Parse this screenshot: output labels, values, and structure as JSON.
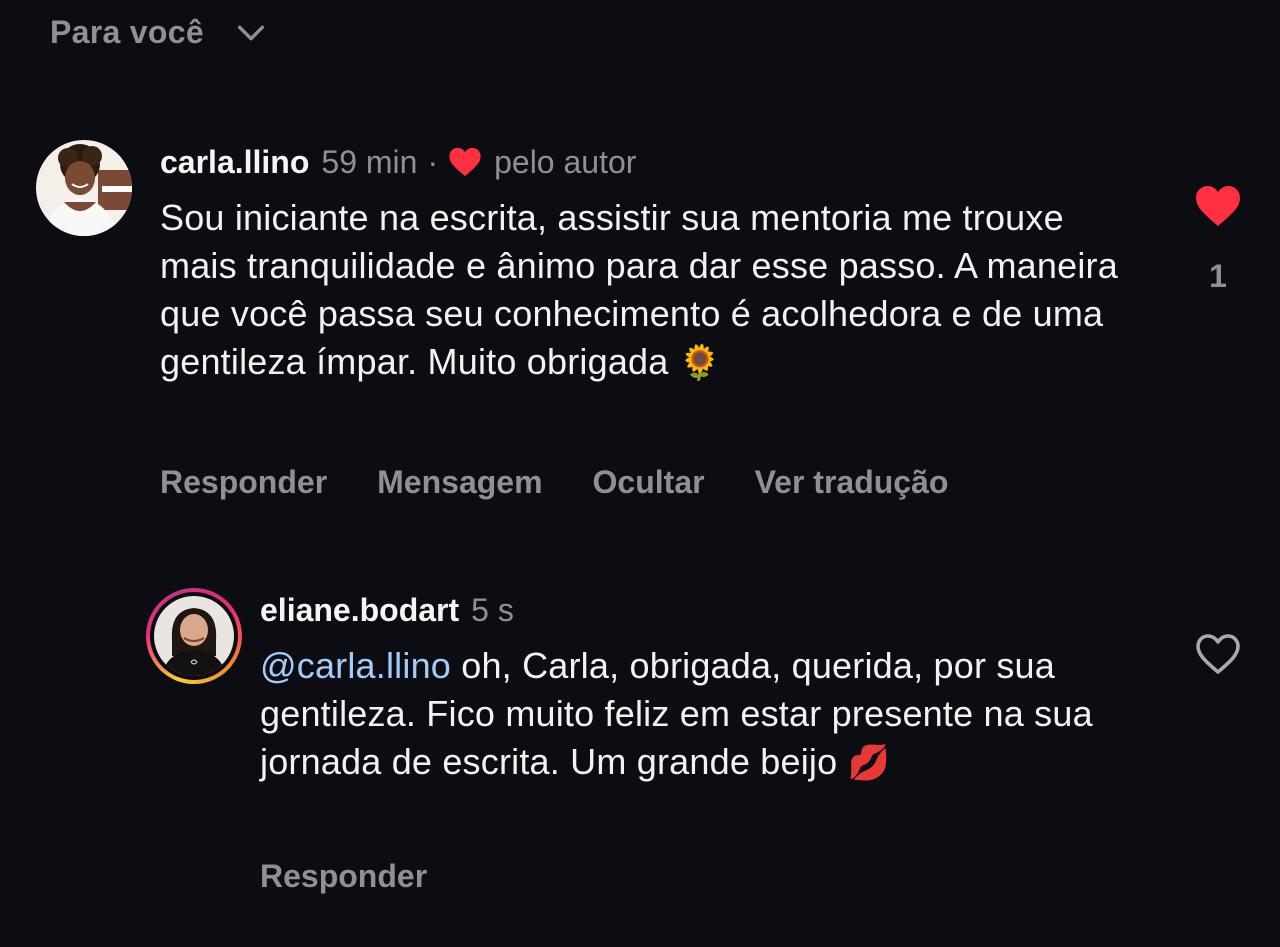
{
  "header": {
    "label": "Para você",
    "dropdown_icon": "chevron-down-icon"
  },
  "comments": [
    {
      "username": "carla.llino",
      "timestamp": "59 min",
      "separator": "·",
      "author_badge": "pelo autor",
      "author_badge_icon": "heart-icon",
      "text": "Sou iniciante na escrita, assistir sua mentoria me trouxe mais tranquilidade e ânimo para dar esse passo. A maneira que você passa seu conhecimento é acolhedora e de uma gentileza ímpar. Muito obrigada",
      "emoji": "🌻",
      "liked": true,
      "like_count": "1",
      "actions": [
        "Responder",
        "Mensagem",
        "Ocultar",
        "Ver tradução"
      ]
    },
    {
      "username": "eliane.bodart",
      "timestamp": "5 s",
      "mention": "@carla.llino",
      "text": " oh, Carla, obrigada, querida, por sua gentileza. Fico muito feliz em estar presente na sua jornada de escrita. Um grande beijo",
      "emoji": "💋",
      "liked": false,
      "actions": [
        "Responder"
      ]
    }
  ],
  "colors": {
    "background": "#0c0d12",
    "muted_text": "#8f9096",
    "mention": "#a4ccf7",
    "like_red": "#ff3040"
  }
}
